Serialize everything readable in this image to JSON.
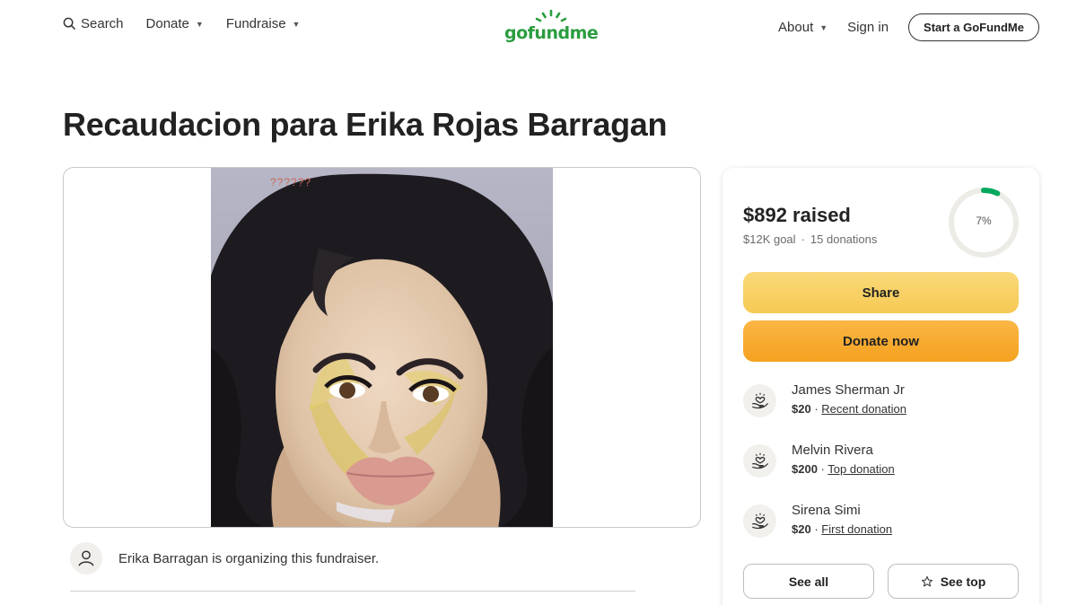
{
  "header": {
    "search_label": "Search",
    "donate_label": "Donate",
    "fundraise_label": "Fundraise",
    "logo_text": "gofundme",
    "about_label": "About",
    "signin_label": "Sign in",
    "start_label": "Start a GoFundMe"
  },
  "campaign": {
    "title": "Recaudacion para Erika Rojas Barragan",
    "photo_overlay_text": "??????",
    "organizer_text": "Erika Barragan is organizing this fundraiser."
  },
  "progress": {
    "raised": "$892 raised",
    "goal": "$12K goal",
    "separator": "·",
    "donations": "15 donations",
    "percent_label": "7%",
    "percent_value": 7
  },
  "actions": {
    "share_label": "Share",
    "donate_now_label": "Donate now",
    "see_all_label": "See all",
    "see_top_label": "See top"
  },
  "donors": [
    {
      "name": "James Sherman Jr",
      "amount": "$20",
      "separator": "·",
      "tag": "Recent donation"
    },
    {
      "name": "Melvin Rivera",
      "amount": "$200",
      "separator": "·",
      "tag": "Top donation"
    },
    {
      "name": "Sirena Simi",
      "amount": "$20",
      "separator": "·",
      "tag": "First donation"
    }
  ],
  "colors": {
    "brand_green": "#2a9d3f",
    "share_yellow": "#f6c953",
    "donate_orange": "#f4a11f",
    "progress_green": "#02a95c"
  },
  "icons": [
    "search-icon",
    "caret-down-icon",
    "sun-logo-icon",
    "user-icon",
    "heart-hand-icon",
    "star-icon"
  ]
}
